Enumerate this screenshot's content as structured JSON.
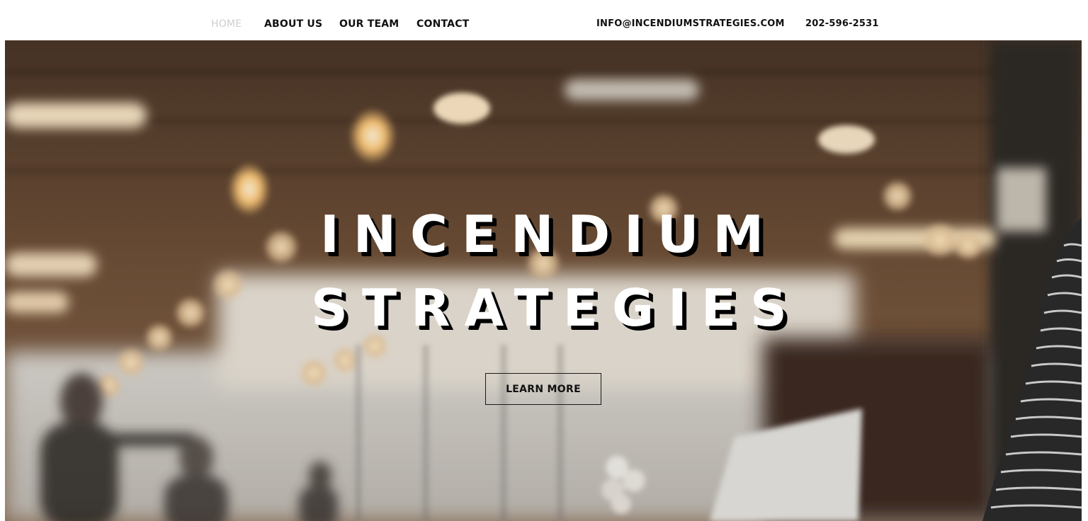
{
  "nav": {
    "items": [
      {
        "label": "HOME",
        "active": true
      },
      {
        "label": "ABOUT US",
        "active": false
      },
      {
        "label": "OUR TEAM",
        "active": false
      },
      {
        "label": "CONTACT",
        "active": false
      }
    ],
    "email": "INFO@INCENDIUMSTRATEGIES.COM",
    "phone": "202-596-2531"
  },
  "hero": {
    "title_line1": "INCENDIUM",
    "title_line2": "STRATEGIES",
    "cta_label": "LEARN MORE"
  },
  "colors": {
    "nav_text": "#111111",
    "nav_active": "#cfcfcf",
    "headline_fill": "#ffffff",
    "headline_shadow": "#000000",
    "ceiling_wood": "#6e4f37",
    "warm_light": "#ffdca0"
  }
}
